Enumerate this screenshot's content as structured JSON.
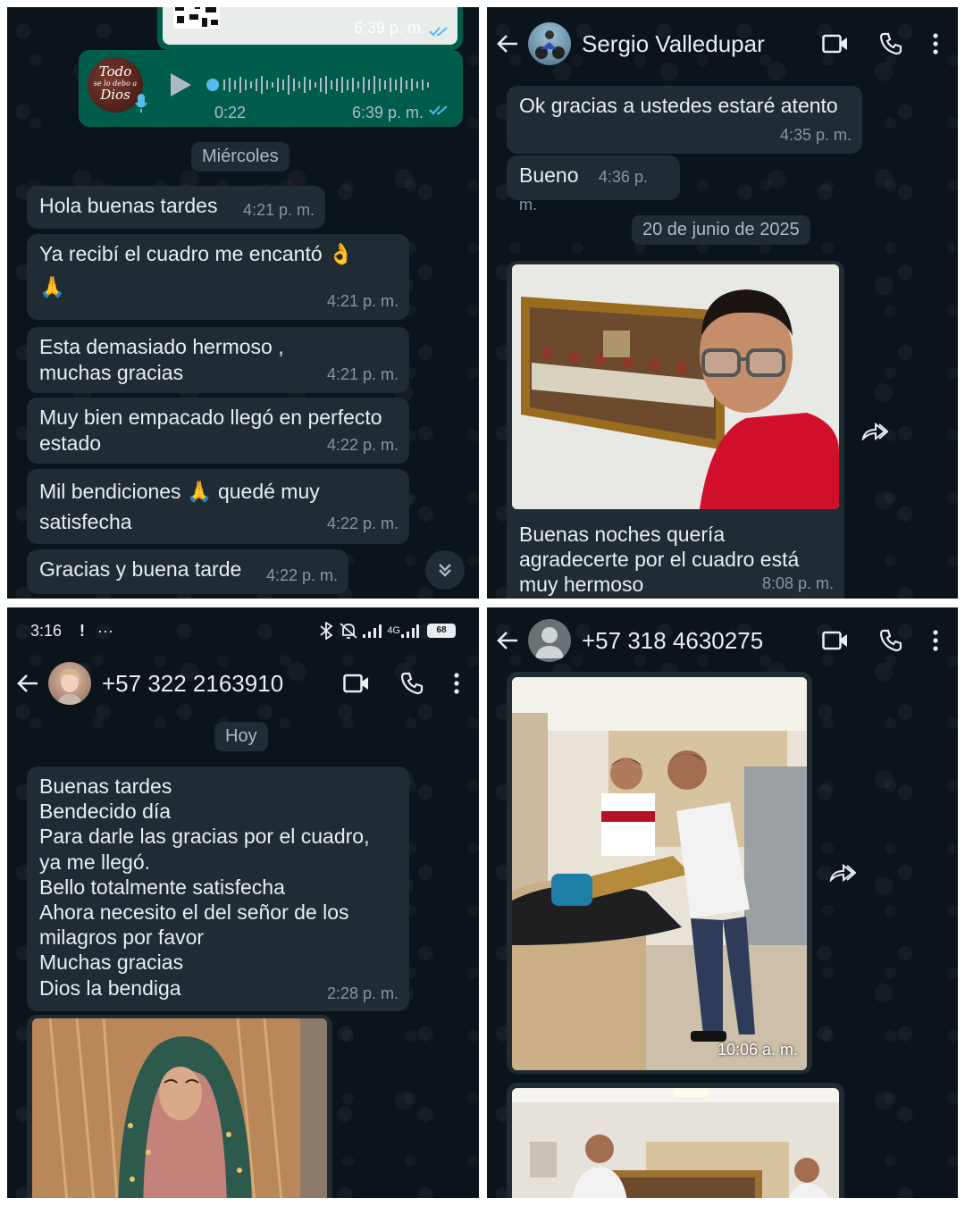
{
  "panel1": {
    "image_message": {
      "time": "6:39 p. m."
    },
    "voice_note": {
      "sticker_text_1": "Todo",
      "sticker_text_2": "se lo debo a",
      "sticker_text_3": "Dios",
      "duration": "0:22",
      "time": "6:39 p. m."
    },
    "date_chip": "Miércoles",
    "messages": [
      {
        "text": "Hola buenas tardes",
        "time": "4:21 p. m."
      },
      {
        "text": "Ya recibí el cuadro  me encantó 👌",
        "text2": "🙏",
        "time": "4:21 p. m."
      },
      {
        "text": "Esta demasiado hermoso , muchas gracias",
        "time": "4:21 p. m."
      },
      {
        "text": "Muy bien empacado llegó en perfecto estado",
        "time": "4:22 p. m."
      },
      {
        "text": "Mil bendiciones 🙏 quedé muy satisfecha",
        "time": "4:22 p. m."
      },
      {
        "text": "Gracias y buena tarde",
        "time": "4:22 p. m."
      }
    ]
  },
  "panel2": {
    "header": {
      "contact_name": "Sergio Valledupar"
    },
    "messages": [
      {
        "text": "Ok gracias a ustedes estaré atento",
        "time": "4:35 p. m."
      },
      {
        "text": "Bueno",
        "time": "4:36 p. m."
      }
    ],
    "date_chip": "20 de junio de 2025",
    "photo_caption": "Buenas noches quería agradecerte por el cuadro está muy hermoso",
    "photo_time": "8:08 p. m."
  },
  "panel3": {
    "status_bar": {
      "time": "3:16",
      "alert": "!",
      "more": "···",
      "network": "4G",
      "battery": "68"
    },
    "header": {
      "contact_name": "+57 322 2163910"
    },
    "date_chip": "Hoy",
    "message": {
      "lines": [
        "Buenas tardes",
        "Bendecido día",
        "Para darle las gracias por el cuadro,",
        "ya me llegó.",
        "Bello totalmente satisfecha",
        "Ahora necesito el del señor de los",
        "milagros por favor",
        "Muchas gracias",
        "Dios la bendiga"
      ],
      "time": "2:28 p. m."
    }
  },
  "panel4": {
    "header": {
      "contact_name": "+57 318 4630275"
    },
    "photo_time": "10:06 a. m."
  },
  "colors": {
    "chat_background": "#0b141a",
    "incoming_bubble": "#202c33",
    "outgoing_bubble": "#005c4b",
    "timestamp": "#8696a0",
    "read_ticks": "#53bdeb"
  },
  "icons": [
    "back-arrow-icon",
    "video-call-icon",
    "phone-icon",
    "menu-dots-icon",
    "play-icon",
    "mic-icon",
    "read-ticks-icon",
    "forward-icon",
    "scroll-down-icon",
    "bluetooth-icon",
    "mute-icon",
    "signal-icon",
    "battery-icon"
  ]
}
